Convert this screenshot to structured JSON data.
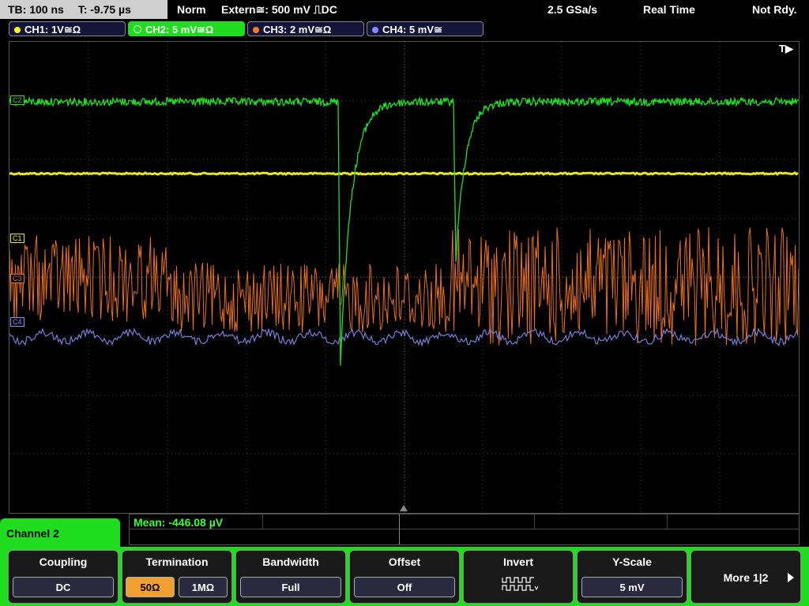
{
  "topbar": {
    "timebase": "TB: 100 ns",
    "trigger_time": "T: -9.75 µs",
    "mode": "Norm",
    "trigger_source": "Extern≅: 500 mV ⎍DC",
    "sample_rate": "2.5 GSa/s",
    "acq_mode": "Real Time",
    "status": "Not Rdy."
  },
  "channels": [
    {
      "label": "CH1: 1V≅Ω",
      "color": "#ffff20"
    },
    {
      "label": "CH2: 5 mV≅Ω",
      "color": "#20ff20",
      "active": true
    },
    {
      "label": "CH3: 2 mV≅Ω",
      "color": "#ff7a20"
    },
    {
      "label": "CH4: 5 mV≅",
      "color": "#8a8aff"
    }
  ],
  "markers": {
    "trigger": "T▶",
    "c1": "C1",
    "c2": "C2",
    "c3": "C3",
    "c4": "C4"
  },
  "measurement": {
    "mean": "Mean: -446.08 µV"
  },
  "panel": {
    "channel_label": "Channel 2",
    "coupling": {
      "title": "Coupling",
      "value": "DC"
    },
    "termination": {
      "title": "Termination",
      "opt1": "50Ω",
      "opt2": "1MΩ"
    },
    "bandwidth": {
      "title": "Bandwidth",
      "value": "Full"
    },
    "offset": {
      "title": "Offset",
      "value": "Off"
    },
    "invert": {
      "title": "Invert",
      "icon": "inverted-square-wave-icon"
    },
    "yscale": {
      "title": "Y-Scale",
      "value": "5 mV"
    },
    "more": {
      "label": "More 1|2"
    }
  }
}
